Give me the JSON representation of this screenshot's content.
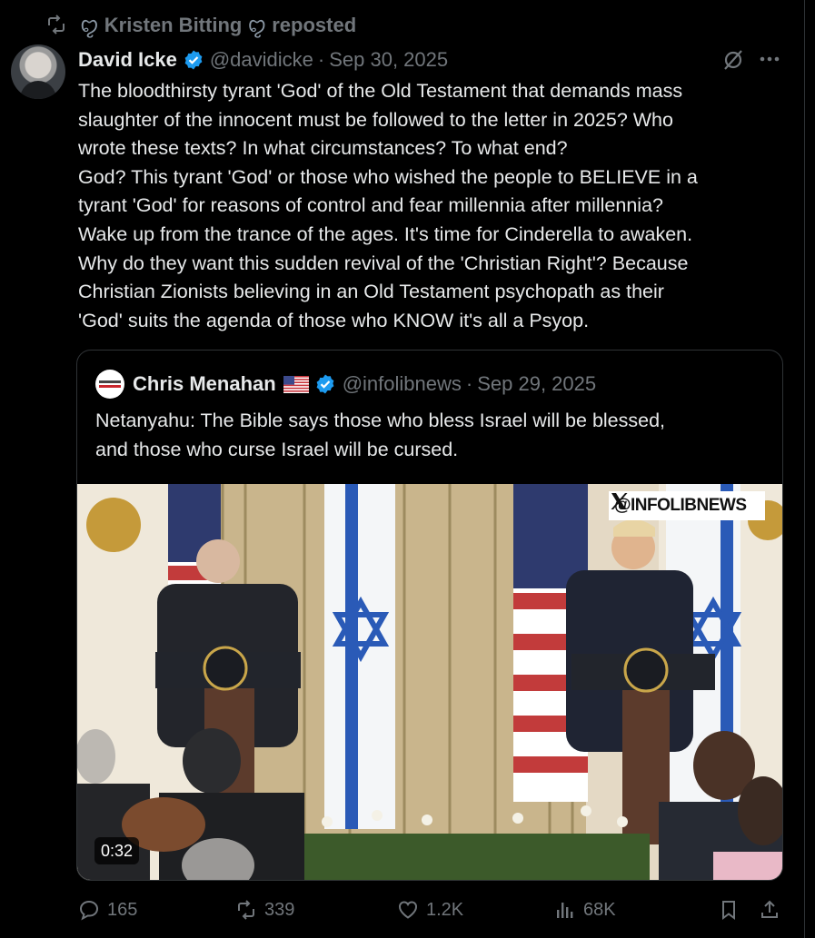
{
  "repost": {
    "user": "Kristen Bitting",
    "deco_left": "ꨄ",
    "deco_right": "ꨄ",
    "suffix": "reposted"
  },
  "tweet": {
    "display_name": "David Icke",
    "handle": "@davidicke",
    "separator": "·",
    "date": "Sep 30, 2025",
    "text": "The bloodthirsty tyrant 'God' of the Old Testament that demands mass\nslaughter of the innocent must be followed to the letter in 2025? Who\nwrote these texts? In what circumstances? To what end?\nGod? This tyrant 'God' or those who wished the people to BELIEVE in a\ntyrant 'God' for reasons of control and fear millennia after millennia?\nWake up from the trance of the ages. It's time for Cinderella to awaken.\nWhy do they want this sudden revival of the 'Christian Right'? Because\nChristian Zionists believing in an Old Testament psychopath as their\n'God' suits the agenda of those who KNOW it's all a Psyop."
  },
  "quote": {
    "display_name": "Chris Menahan",
    "handle": "@infolibnews",
    "separator": "·",
    "date": "Sep 29, 2025",
    "text": "Netanyahu: The Bible says those who bless Israel will be blessed,\nand those who curse Israel will be cursed.",
    "media": {
      "watermark": "@INFOLIBNEWS",
      "duration": "0:32"
    }
  },
  "actions": {
    "replies": "165",
    "reposts": "339",
    "likes": "1.2K",
    "views": "68K"
  },
  "colors": {
    "background": "#000000",
    "text": "#e7e9ea",
    "muted": "#71767b",
    "verified": "#1d9bf0",
    "border": "#2f3336"
  },
  "icons": [
    "repost-icon",
    "verified-badge-icon",
    "grok-icon",
    "more-icon",
    "us-flag-icon",
    "x-logo-icon",
    "reply-icon",
    "like-icon",
    "views-icon",
    "bookmark-icon",
    "share-icon"
  ]
}
